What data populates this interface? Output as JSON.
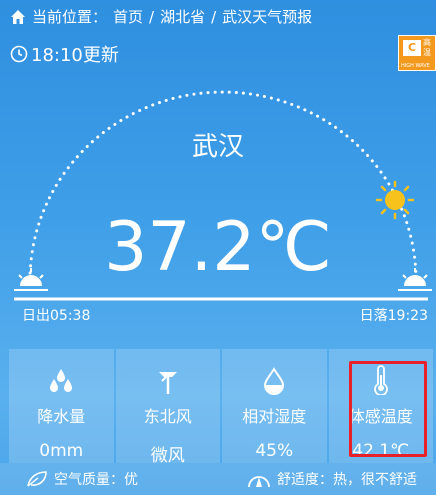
{
  "breadcrumb": {
    "prefix": "当前位置：",
    "home": "首页",
    "sep": "/",
    "province": "湖北省",
    "page": "武汉天气预报"
  },
  "update_time": "18:10更新",
  "city": "武汉",
  "temperature": "37.2℃",
  "sunrise": "日出05:38",
  "sunset": "日落19:23",
  "cards": [
    {
      "label": "降水量",
      "value": "0mm",
      "icon": "raindrop-icon"
    },
    {
      "label": "东北风",
      "value": "微风",
      "icon": "wind-vane-icon"
    },
    {
      "label": "相对湿度",
      "value": "45%",
      "icon": "humidity-drop-icon"
    },
    {
      "label": "体感温度",
      "value": "42.1℃",
      "icon": "thermometer-icon"
    }
  ],
  "air_quality": "空气质量：优",
  "comfort": "舒适度：热，很不舒适",
  "badge": {
    "letter": "C",
    "side": "高温",
    "foot": "HIGH WAVE"
  },
  "colors": {
    "background": "#3f9fe8",
    "highlight": "#e8202a",
    "badge": "#f39a1e",
    "sun": "#f7c21b"
  }
}
